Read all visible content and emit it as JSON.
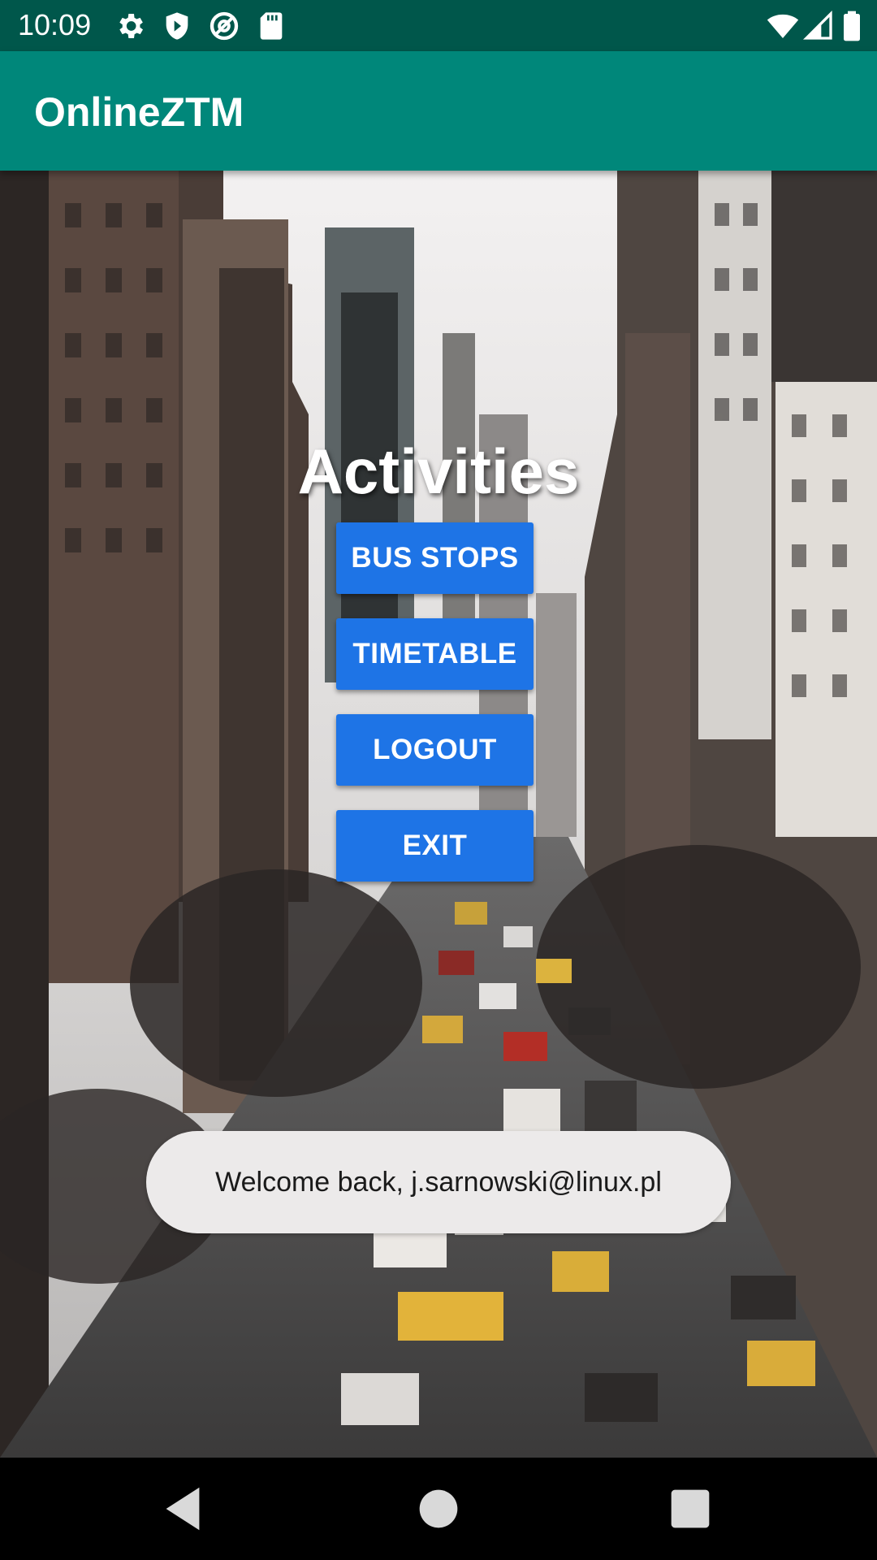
{
  "status_bar": {
    "time": "10:09",
    "left_icons": [
      "gear-icon",
      "shield-icon",
      "at-sign-icon",
      "sd-card-icon"
    ],
    "right_icons": [
      "wifi-icon",
      "signal-icon",
      "battery-icon"
    ]
  },
  "app_bar": {
    "title": "OnlineZTM",
    "color": "#00877a",
    "status_color": "#00574b"
  },
  "main": {
    "heading": "Activities",
    "buttons": [
      {
        "label": "BUS STOPS"
      },
      {
        "label": "TIMETABLE"
      },
      {
        "label": "LOGOUT"
      },
      {
        "label": "EXIT"
      }
    ],
    "button_color": "#1e74e6",
    "background": "city street photo with traffic and skyscrapers"
  },
  "toast": {
    "message": "Welcome back, j.sarnowski@linux.pl"
  },
  "nav_bar": {
    "icons": [
      "back-icon",
      "home-icon",
      "recents-icon"
    ]
  }
}
